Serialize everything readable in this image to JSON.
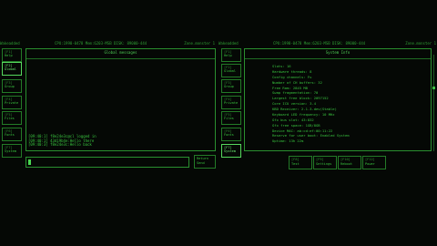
{
  "left": {
    "header": {
      "title": "Wakeadded",
      "stats": "CPU:1998-0478 Mem:6203-MSB DISK: 89000-444",
      "zone": "Zone.monster 1"
    },
    "tabs": [
      {
        "key": "[F1]",
        "label": "Help"
      },
      {
        "key": "[F2]",
        "label": "Global"
      },
      {
        "key": "[F3]",
        "label": "Group"
      },
      {
        "key": "[F4]",
        "label": "Private"
      },
      {
        "key": "[F5]",
        "label": "Files"
      },
      {
        "key": "[F6]",
        "label": "Fonts"
      },
      {
        "key": "[F7]",
        "label": "System"
      }
    ],
    "panel_title": "Global messages",
    "messages": [
      "[09:40:1] f8e24e3c@cl logged in",
      "[09:40:1] 43d19b4e:Hello there",
      "[09:40:3] f8e24e3c:Hello back"
    ],
    "input_value": "",
    "send_button": "Return\nSend"
  },
  "right": {
    "header": {
      "title": "Wakeadded",
      "stats": "CPU:1998-0478 Mem:6203-MSB DISK: 89000-444",
      "zone": "Zone.monster 1"
    },
    "tabs": [
      {
        "key": "[F1]",
        "label": "Help"
      },
      {
        "key": "[F2]",
        "label": "Global"
      },
      {
        "key": "[F3]",
        "label": "Group"
      },
      {
        "key": "[F4]",
        "label": "Private"
      },
      {
        "key": "[F5]",
        "label": "Files"
      },
      {
        "key": "[F6]",
        "label": "Fonts"
      },
      {
        "key": "[F7]",
        "label": "System"
      }
    ],
    "panel_title": "System Info",
    "info_lines": [
      "Slots: 16",
      "Hardware threads: 8",
      "Config channels: Fu",
      "Number of CH buffers: 32",
      "Free Ram: 2845 MB",
      "Swap fragmentation: 70",
      "Largest free block: 2097152",
      "Core ICU version: 3.4",
      "KBD Receiver: 2.1.3-dev(Stable)",
      "Keyboard LED frequency: 10 MHz",
      "Gfx bus slot: 43:832",
      "Gfx free space: 1GB/8GB",
      "Device MAC: ab:cd:ef:00:11:22",
      "Reserve for user boot: Enabled System",
      "Uptime: 13h 22m"
    ],
    "buttons": [
      {
        "key": "[F8]",
        "label": "Test"
      },
      {
        "key": "[F9]",
        "label": "Settings"
      },
      {
        "key": "[F10]",
        "label": "Reboot"
      },
      {
        "key": "[F12]",
        "label": "Power"
      }
    ]
  }
}
